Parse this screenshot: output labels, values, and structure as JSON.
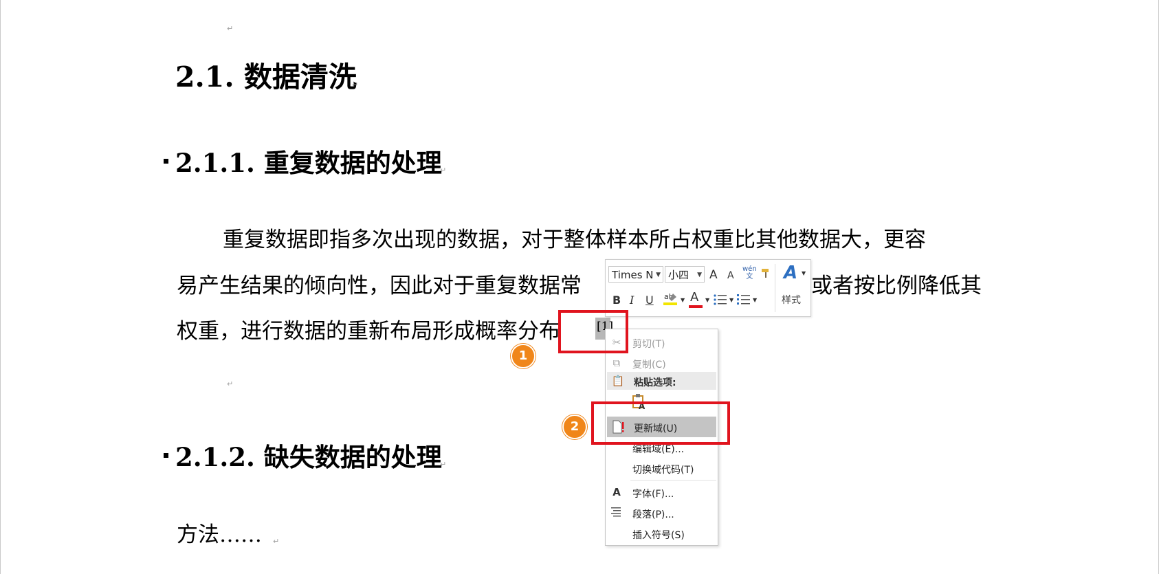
{
  "document": {
    "para_mark": "↵",
    "heading1": "2.1. 数据清洗",
    "heading2a": "2.1.1. 重复数据的处理",
    "para1_line1": "重复数据即指多次出现的数据，对于整体样本所占权重比其他数据大，更容",
    "para1_line2_left": "易产生结果的倾向性，因此对于重复数据常",
    "para1_line2_right": "或者按比例降低其",
    "para1_line3": "权重，进行数据的重新布局形成概率分布",
    "selected_char": "[1]",
    "heading2b": "2.1.2. 缺失数据的处理",
    "para2": "方法……"
  },
  "mini_toolbar": {
    "font_name": "Times N",
    "font_size": "小四",
    "grow_font": "A",
    "shrink_font": "A",
    "phonetic": "wén\n文",
    "bold": "B",
    "italic": "I",
    "underline": "U",
    "font_color": "A",
    "styles_label": "样式"
  },
  "context_menu": {
    "cut": "剪切(T)",
    "copy": "复制(C)",
    "paste_options": "粘贴选项:",
    "update_field": "更新域(U)",
    "edit_field": "编辑域(E)...",
    "toggle_field_codes": "切换域代码(T)",
    "font": "字体(F)...",
    "paragraph": "段落(P)...",
    "insert_symbol": "插入符号(S)"
  },
  "annotations": {
    "step1": "1",
    "step2": "2"
  },
  "colors": {
    "highlight_box": "#e0141e",
    "step_badge": "#f0861a",
    "highlight_marker": "#f2e500",
    "font_color_bar": "#e0141e"
  }
}
